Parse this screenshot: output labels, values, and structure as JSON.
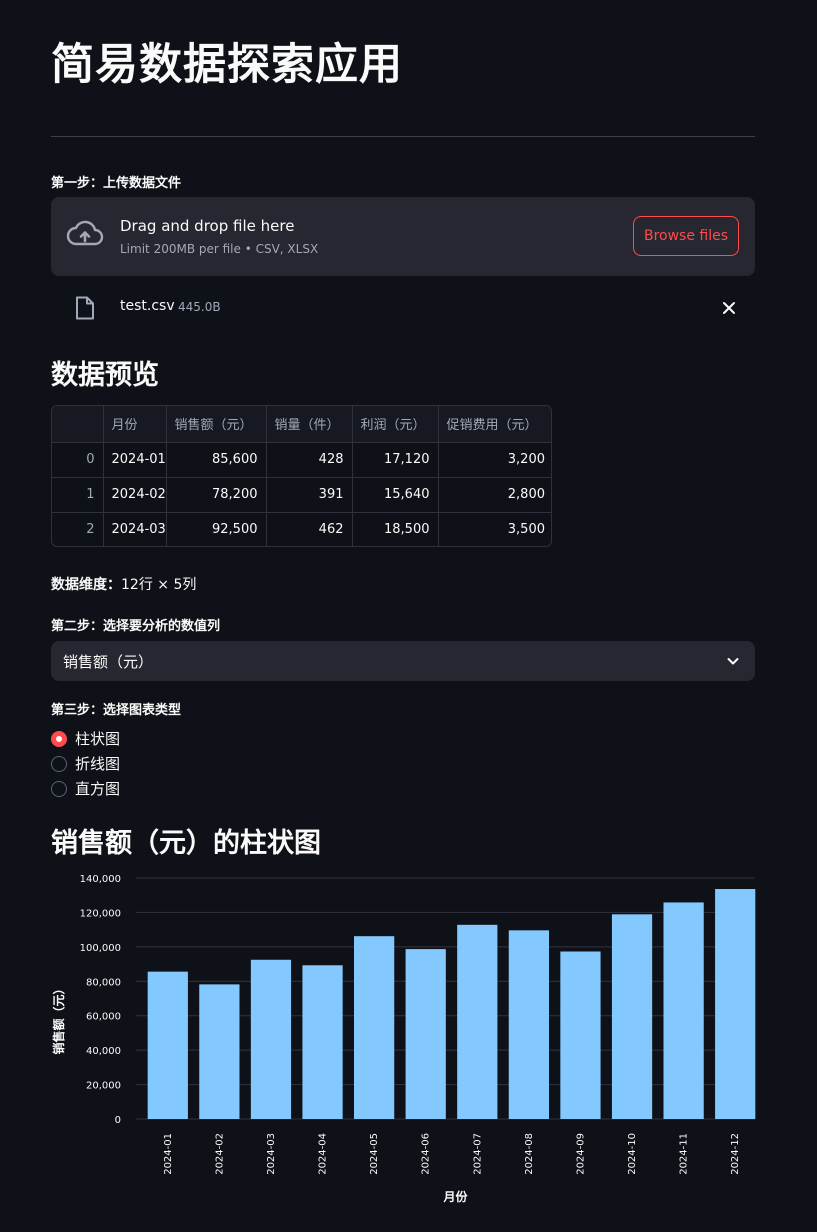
{
  "page": {
    "title": "简易数据探索应用"
  },
  "upload": {
    "step_label": "第一步：上传数据文件",
    "drop_text": "Drag and drop file here",
    "limit_text": "Limit 200MB per file • CSV, XLSX",
    "browse_label": "Browse files",
    "icon": "cloud-upload-icon"
  },
  "file": {
    "name": "test.csv",
    "size": "445.0B",
    "icon": "file-icon"
  },
  "preview": {
    "heading": "数据预览",
    "columns": [
      "",
      "月份",
      "销售额（元）",
      "销量（件）",
      "利润（元）",
      "促销费用（元）"
    ],
    "rows": [
      [
        "0",
        "2024-01",
        "85,600",
        "428",
        "17,120",
        "3,200"
      ],
      [
        "1",
        "2024-02",
        "78,200",
        "391",
        "15,640",
        "2,800"
      ],
      [
        "2",
        "2024-03",
        "92,500",
        "462",
        "18,500",
        "3,500"
      ]
    ],
    "dims_label": "数据维度：",
    "dims_value": "12行 × 5列"
  },
  "column_select": {
    "step_label": "第二步：选择要分析的数值列",
    "value": "销售额（元）"
  },
  "chart_type": {
    "step_label": "第三步：选择图表类型",
    "options": [
      "柱状图",
      "折线图",
      "直方图"
    ],
    "selected": 0,
    "accent": "#ff4b4b"
  },
  "chart_section": {
    "heading": "销售额（元）的柱状图"
  },
  "chart_data": {
    "type": "bar",
    "categories": [
      "2024-01",
      "2024-02",
      "2024-03",
      "2024-04",
      "2024-05",
      "2024-06",
      "2024-07",
      "2024-08",
      "2024-09",
      "2024-10",
      "2024-11",
      "2024-12"
    ],
    "values": [
      85600,
      78200,
      92500,
      89300,
      106200,
      98700,
      112800,
      109600,
      97300,
      118900,
      125800,
      133600
    ],
    "xlabel": "月份",
    "ylabel": "销售额（元）",
    "ylim": [
      0,
      140000
    ],
    "yticks": [
      "0",
      "20,000",
      "40,000",
      "60,000",
      "80,000",
      "100,000",
      "120,000",
      "140,000"
    ],
    "ytick_values": [
      0,
      20000,
      40000,
      60000,
      80000,
      100000,
      120000,
      140000
    ],
    "grid": true,
    "bar_color": "#83c9ff"
  }
}
